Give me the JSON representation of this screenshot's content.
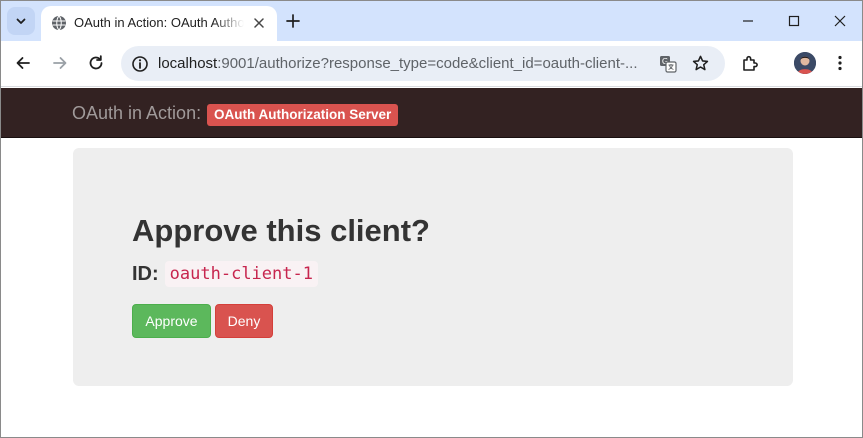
{
  "browser": {
    "tab": {
      "title": "OAuth in Action: OAuth Authorization Server"
    },
    "address_bar": {
      "host": "localhost",
      "rest": ":9001/authorize?response_type=code&client_id=oauth-client-..."
    }
  },
  "page": {
    "navbar": {
      "brand": "OAuth in Action:",
      "label": "OAuth Authorization Server"
    },
    "approve": {
      "heading": "Approve this client?",
      "id_label": "ID:",
      "client_id": "oauth-client-1",
      "approve_button": "Approve",
      "deny_button": "Deny"
    }
  },
  "colors": {
    "navbar": "#332222",
    "label": "#d9534f",
    "approve": "#5cb85c",
    "deny": "#d9534f",
    "code": "#c7254e"
  }
}
